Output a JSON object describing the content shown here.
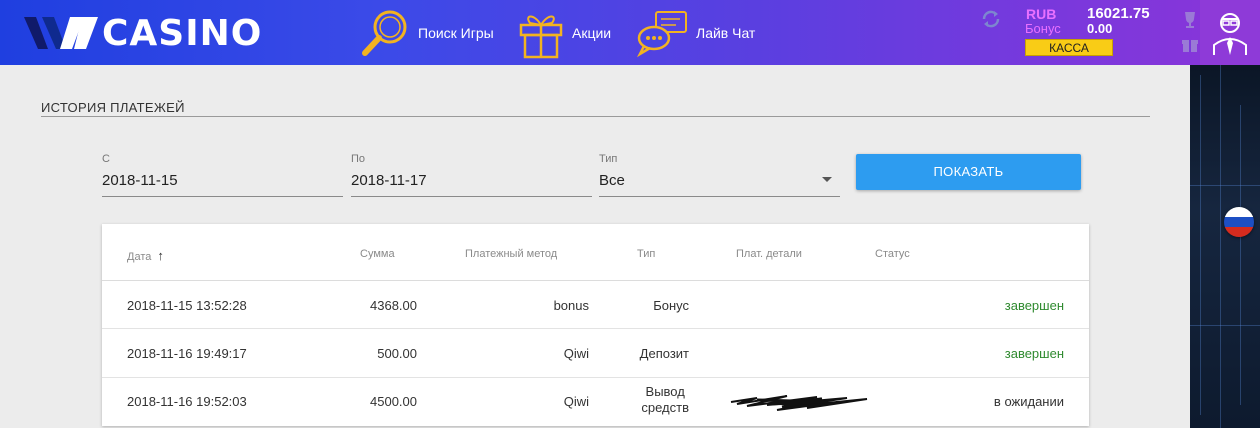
{
  "header": {
    "logo_text": "CASINO",
    "nav": [
      {
        "label": "Поиск Игры",
        "icon": "search-icon"
      },
      {
        "label": "Акции",
        "icon": "gift-icon"
      },
      {
        "label": "Лайв Чат",
        "icon": "chat-icon"
      }
    ],
    "balance": {
      "currency": "RUB",
      "amount": "16021.75",
      "bonus_label": "Бонус",
      "bonus_amount": "0.00",
      "cashier_label": "КАССА"
    }
  },
  "page": {
    "section_title": "ИСТОРИЯ ПЛАТЕЖЕЙ",
    "filters": {
      "from_label": "С",
      "from_value": "2018-11-15",
      "to_label": "По",
      "to_value": "2018-11-17",
      "type_label": "Тип",
      "type_value": "Все",
      "show_button": "ПОКАЗАТЬ"
    },
    "table": {
      "columns": [
        "Дата",
        "Сумма",
        "Платежный метод",
        "Тип",
        "Плат. детали",
        "Статус"
      ],
      "sort_indicator": "↑",
      "rows": [
        {
          "date": "2018-11-15 13:52:28",
          "amount": "4368.00",
          "method": "bonus",
          "type_line1": "Бонус",
          "type_line2": "",
          "details": "",
          "status": "завершен"
        },
        {
          "date": "2018-11-16 19:49:17",
          "amount": "500.00",
          "method": "Qiwi",
          "type_line1": "Депозит",
          "type_line2": "",
          "details": "",
          "status": "завершен"
        },
        {
          "date": "2018-11-16 19:52:03",
          "amount": "4500.00",
          "method": "Qiwi",
          "type_line1": "Вывод",
          "type_line2": "средств",
          "details": "",
          "status": "в ожидании"
        }
      ]
    }
  },
  "colors": {
    "accent_blue": "#2d9cf0",
    "status_done": "#2f8a2f",
    "cashier_yellow": "#f9cc16",
    "bonus_pink": "#e970ff"
  }
}
